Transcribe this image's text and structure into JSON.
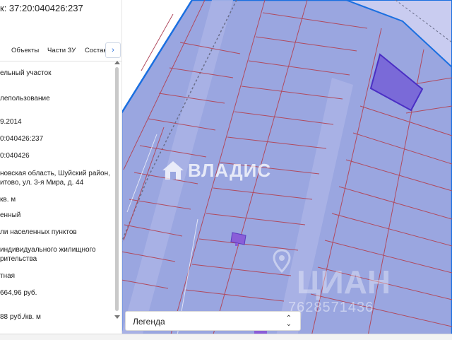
{
  "panel": {
    "title": "к: 37:20:040426:237",
    "tabs": [
      {
        "label": "Объекты"
      },
      {
        "label": "Части ЗУ"
      },
      {
        "label": "Состав"
      }
    ],
    "tab_next": "›",
    "fields": [
      {
        "lines": [
          "ельный участок"
        ]
      },
      {
        "lines": [
          "лепользование"
        ]
      },
      {
        "lines": [
          "9.2014"
        ]
      },
      {
        "lines": [
          "0:040426:237"
        ]
      },
      {
        "lines": [
          "0:040426"
        ]
      },
      {
        "lines": [
          "новская область, Шуйский район,",
          "итово, ул. 3-я Мира, д. 44"
        ]
      },
      {
        "lines": [
          "кв. м"
        ]
      },
      {
        "lines": [
          "енный"
        ]
      },
      {
        "lines": [
          "ли населенных пунктов"
        ]
      },
      {
        "lines": [
          "индивидуального жилищного",
          "рительства"
        ]
      },
      {
        "lines": [
          "тная"
        ]
      },
      {
        "lines": [
          "664,96 руб."
        ]
      },
      {
        "lines": [
          "88 руб./кв. м"
        ]
      }
    ]
  },
  "legend": {
    "label": "Легенда"
  },
  "watermarks": {
    "vladis": "ВЛАДИС",
    "cian": "ЦИАН",
    "phone": "7628571436"
  },
  "colors": {
    "map_fill": "#9aa6e0",
    "map_outline": "#1a6fe0",
    "parcel_line": "#b04a5e",
    "highlight": "#7060d8",
    "outside": "#ffffff"
  },
  "icons": {
    "tab_next": "chevron-right-icon",
    "legend_toggle": "chevron-updown-icon",
    "vladis_logo": "house-icon",
    "cian_pin": "map-pin-icon"
  }
}
